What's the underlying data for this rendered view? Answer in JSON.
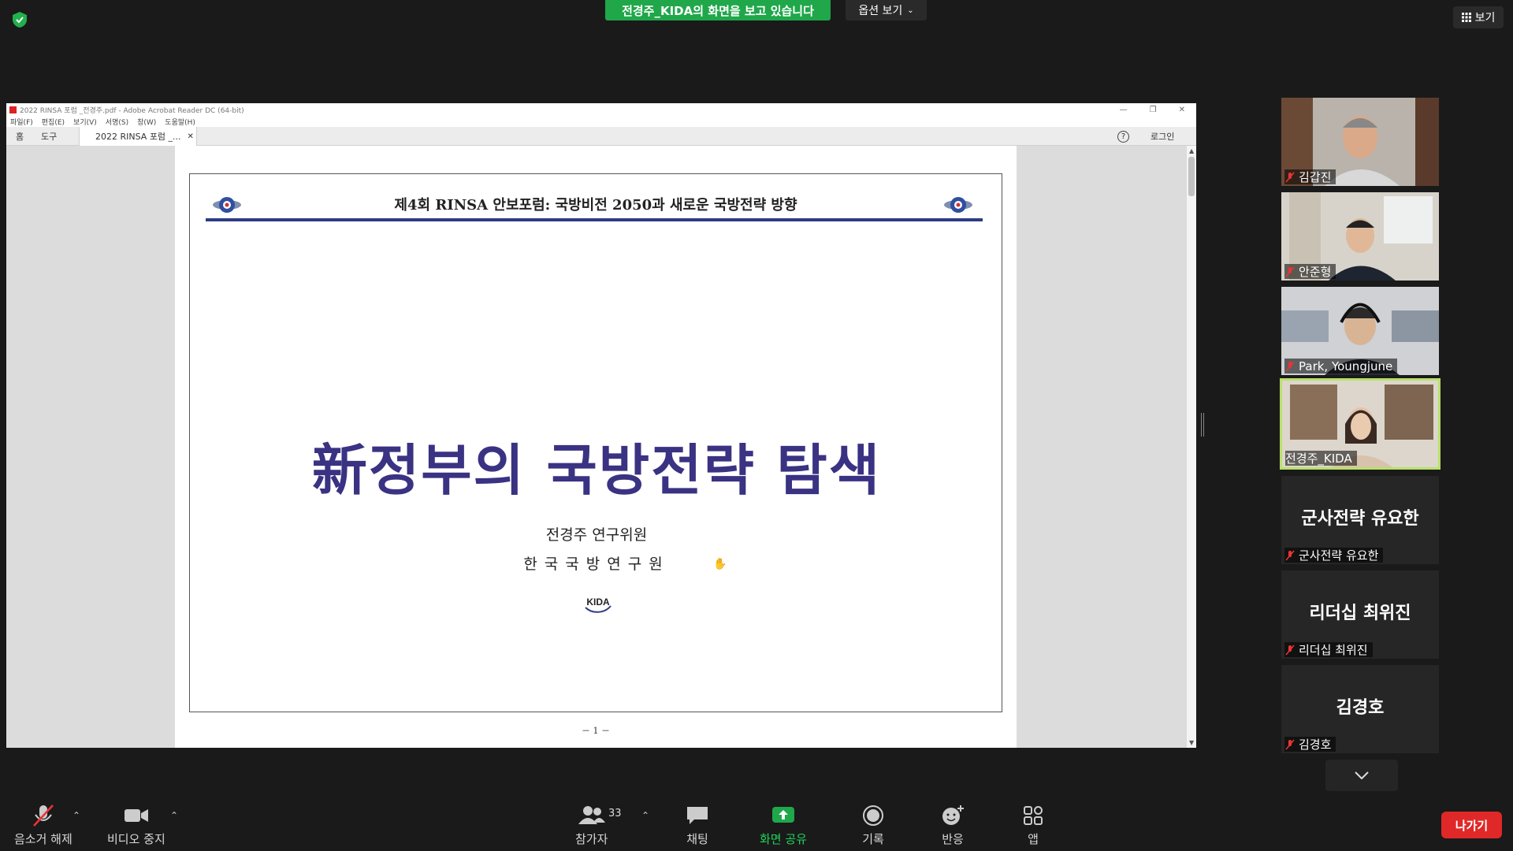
{
  "top": {
    "share_banner": "전경주_KIDA의 화면을 보고 있습니다",
    "view_options": "옵션 보기",
    "view_button": "보기"
  },
  "acrobat": {
    "title": "2022 RINSA 포럼 _전경주.pdf - Adobe Acrobat Reader DC (64-bit)",
    "menu": [
      "파일(F)",
      "편집(E)",
      "보기(V)",
      "서명(S)",
      "창(W)",
      "도움말(H)"
    ],
    "tab_home": "홈",
    "tab_tools": "도구",
    "doc_tab": "2022 RINSA 포럼 _...",
    "help": "?",
    "login": "로그인"
  },
  "slide": {
    "header": "제4회 RINSA 안보포럼: 국방비전 2050과 새로운 국방전략 방향",
    "title": "新정부의 국방전략 탐색",
    "presenter": "전경주 연구위원",
    "organization": "한국국방연구원",
    "logo_text": "KIDA",
    "page_number": "－ 1 －"
  },
  "participants": [
    {
      "name": "김갑진",
      "muted": true,
      "video": true
    },
    {
      "name": "안준형",
      "muted": true,
      "video": true
    },
    {
      "name": "Park, Youngjune",
      "muted": true,
      "video": true
    },
    {
      "name": "전경주_KIDA",
      "muted": false,
      "video": true,
      "active_speaker": true
    },
    {
      "name": "군사전략 유요한",
      "muted": true,
      "video": false
    },
    {
      "name": "리더십 최위진",
      "muted": true,
      "video": false
    },
    {
      "name": "김경호",
      "muted": true,
      "video": false
    }
  ],
  "toolbar": {
    "unmute": "음소거 해제",
    "stop_video": "비디오 중지",
    "participants": "참가자",
    "participant_count": "33",
    "chat": "채팅",
    "share_screen": "화면 공유",
    "record": "기록",
    "reactions": "반응",
    "apps": "앱",
    "leave": "나가기"
  },
  "colors": {
    "share_green": "#1fa74a",
    "leave_red": "#e02828",
    "slide_title": "#3a3282",
    "active_speaker": "#b7e06a"
  }
}
